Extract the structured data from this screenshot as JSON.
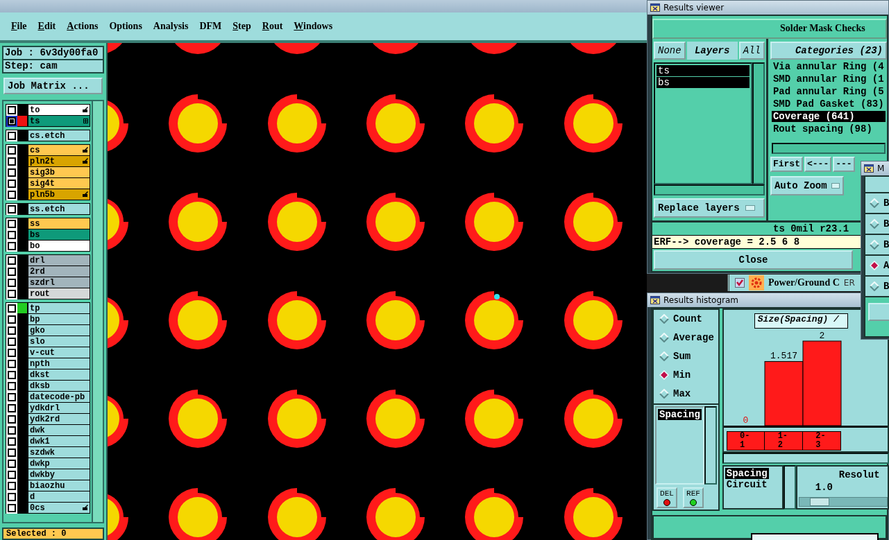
{
  "main_window": {
    "menu": [
      {
        "label": "File",
        "mnemonic": true
      },
      {
        "label": "Edit",
        "mnemonic": true
      },
      {
        "label": "Actions",
        "mnemonic": true
      },
      {
        "label": "Options",
        "mnemonic": false
      },
      {
        "label": "Analysis",
        "mnemonic": false
      },
      {
        "label": "DFM",
        "mnemonic": false
      },
      {
        "label": "Step",
        "mnemonic": true
      },
      {
        "label": "Rout",
        "mnemonic": true
      },
      {
        "label": "Windows",
        "mnemonic": true
      }
    ]
  },
  "left_panel": {
    "job": "Job : 6v3dy00fa0",
    "step": "Step: cam",
    "job_matrix_button": "Job Matrix ...",
    "layer_groups": [
      {
        "layers": [
          {
            "name": "to",
            "color": "#ffffff",
            "selected": false,
            "kind": "hand"
          },
          {
            "name": "ts",
            "color": "#0e9a7a",
            "swatch": {
              "color": "#ee1111"
            },
            "selected": true,
            "kind": "grid"
          }
        ]
      },
      {
        "layers": [
          {
            "name": "cs.etch",
            "color": "#9edcdc",
            "selected": false,
            "kind": "plain"
          }
        ]
      },
      {
        "layers": [
          {
            "name": "cs",
            "color": "#ffc850",
            "selected": false,
            "kind": "hand"
          },
          {
            "name": "pln2t",
            "color": "#d8a400",
            "selected": false,
            "kind": "hand"
          },
          {
            "name": "sig3b",
            "color": "#ffc850",
            "selected": false,
            "kind": "plain"
          },
          {
            "name": "sig4t",
            "color": "#ffc850",
            "selected": false,
            "kind": "plain"
          },
          {
            "name": "pln5b",
            "color": "#d8a400",
            "selected": false,
            "kind": "hand"
          }
        ]
      },
      {
        "layers": [
          {
            "name": "ss.etch",
            "color": "#9edcdc",
            "selected": false,
            "kind": "plain"
          }
        ]
      },
      {
        "layers": [
          {
            "name": "ss",
            "color": "#ffc850",
            "selected": false,
            "kind": "plain"
          },
          {
            "name": "bs",
            "color": "#0e9a7a",
            "selected": false,
            "kind": "plain"
          },
          {
            "name": "bo",
            "color": "#ffffff",
            "selected": false,
            "kind": "plain"
          }
        ]
      },
      {
        "layers": [
          {
            "name": "drl",
            "color": "#a2b4bc",
            "selected": false,
            "kind": "plain"
          },
          {
            "name": "2rd",
            "color": "#a2b4bc",
            "selected": false,
            "kind": "plain"
          },
          {
            "name": "szdrl",
            "color": "#a2b4bc",
            "selected": false,
            "kind": "plain"
          },
          {
            "name": "rout",
            "color": "#d4d8d8",
            "selected": false,
            "kind": "plain"
          }
        ]
      },
      {
        "layers": [
          {
            "name": "tp",
            "color": "#9edcdc",
            "swatch": {
              "color": "#22cc22"
            },
            "selected": false,
            "kind": "plain"
          },
          {
            "name": "bp",
            "color": "#9edcdc",
            "selected": false,
            "kind": "plain"
          },
          {
            "name": "gko",
            "color": "#9edcdc",
            "selected": false,
            "kind": "plain"
          },
          {
            "name": "slo",
            "color": "#9edcdc",
            "selected": false,
            "kind": "plain"
          },
          {
            "name": "v-cut",
            "color": "#9edcdc",
            "selected": false,
            "kind": "plain"
          },
          {
            "name": "npth",
            "color": "#9edcdc",
            "selected": false,
            "kind": "plain"
          },
          {
            "name": "dkst",
            "color": "#9edcdc",
            "selected": false,
            "kind": "plain"
          },
          {
            "name": "dksb",
            "color": "#9edcdc",
            "selected": false,
            "kind": "plain"
          },
          {
            "name": "datecode-pb",
            "color": "#9edcdc",
            "selected": false,
            "kind": "plain"
          },
          {
            "name": "ydkdrl",
            "color": "#9edcdc",
            "selected": false,
            "kind": "plain"
          },
          {
            "name": "ydk2rd",
            "color": "#9edcdc",
            "selected": false,
            "kind": "plain"
          },
          {
            "name": "dwk",
            "color": "#9edcdc",
            "selected": false,
            "kind": "plain"
          },
          {
            "name": "dwk1",
            "color": "#9edcdc",
            "selected": false,
            "kind": "plain"
          },
          {
            "name": "szdwk",
            "color": "#9edcdc",
            "selected": false,
            "kind": "plain"
          },
          {
            "name": "dwkp",
            "color": "#9edcdc",
            "selected": false,
            "kind": "plain"
          },
          {
            "name": "dwkby",
            "color": "#9edcdc",
            "selected": false,
            "kind": "plain"
          },
          {
            "name": "biaozhu",
            "color": "#9edcdc",
            "selected": false,
            "kind": "plain"
          },
          {
            "name": "d",
            "color": "#9edcdc",
            "selected": false,
            "kind": "plain"
          },
          {
            "name": "0cs",
            "color": "#9edcdc",
            "selected": false,
            "kind": "hand"
          }
        ]
      }
    ],
    "selected_count": "Selected : 0"
  },
  "results_viewer": {
    "title": "Results viewer",
    "header": "Solder Mask Checks",
    "layer_buttons": [
      "None",
      "Layers",
      "All"
    ],
    "layers": [
      {
        "name": "ts",
        "selected": true
      },
      {
        "name": "bs",
        "selected": true
      }
    ],
    "replace_button": "Replace layers",
    "categories_button": "Categories (23)",
    "categories": [
      {
        "label": "Via annular Ring (4",
        "selected": false
      },
      {
        "label": "SMD annular Ring (1",
        "selected": false
      },
      {
        "label": "Pad annular Ring (5",
        "selected": false
      },
      {
        "label": "SMD Pad Gasket (83)",
        "selected": false
      },
      {
        "label": "Coverage (641)",
        "selected": true
      },
      {
        "label": "Rout spacing (98)",
        "selected": false
      }
    ],
    "nav_buttons": [
      "First",
      "<---",
      "---"
    ],
    "zoom_button": "Auto Zoom",
    "status": "ts 0mil  r23.1",
    "command": "ERF--> coverage = 2.5 6 8",
    "close_button": "Close"
  },
  "background_strip": {
    "label": "Power/Ground C",
    "label_2": "ER"
  },
  "mini_window": {
    "title": "M",
    "options": [
      {
        "label": "B",
        "selected": false
      },
      {
        "label": "B",
        "selected": false
      },
      {
        "label": "B",
        "selected": false
      },
      {
        "label": "A",
        "selected": true
      },
      {
        "label": "B",
        "selected": false
      }
    ]
  },
  "histogram": {
    "title": "Results histogram",
    "modes": [
      {
        "label": "Count",
        "selected": false
      },
      {
        "label": "Average",
        "selected": false
      },
      {
        "label": "Sum",
        "selected": false
      },
      {
        "label": "Min",
        "selected": true
      },
      {
        "label": "Max",
        "selected": false
      }
    ],
    "attributes": [
      {
        "label": "Spacing",
        "selected": true
      }
    ],
    "del_button": "DEL",
    "ref_button": "REF",
    "chart_data": {
      "type": "bar",
      "title": "Size(Spacing) / ",
      "categories": [
        "0-1",
        "1-2",
        "2-3"
      ],
      "values": [
        0,
        1.517,
        2
      ],
      "data_labels": true
    },
    "fields": [
      {
        "label": "Spacing",
        "selected": true
      },
      {
        "label": "Circuit",
        "selected": false
      }
    ],
    "resolution_label": "Resolut",
    "resolution_value": "1.0",
    "resolution": {
      "level": 0.15
    }
  }
}
